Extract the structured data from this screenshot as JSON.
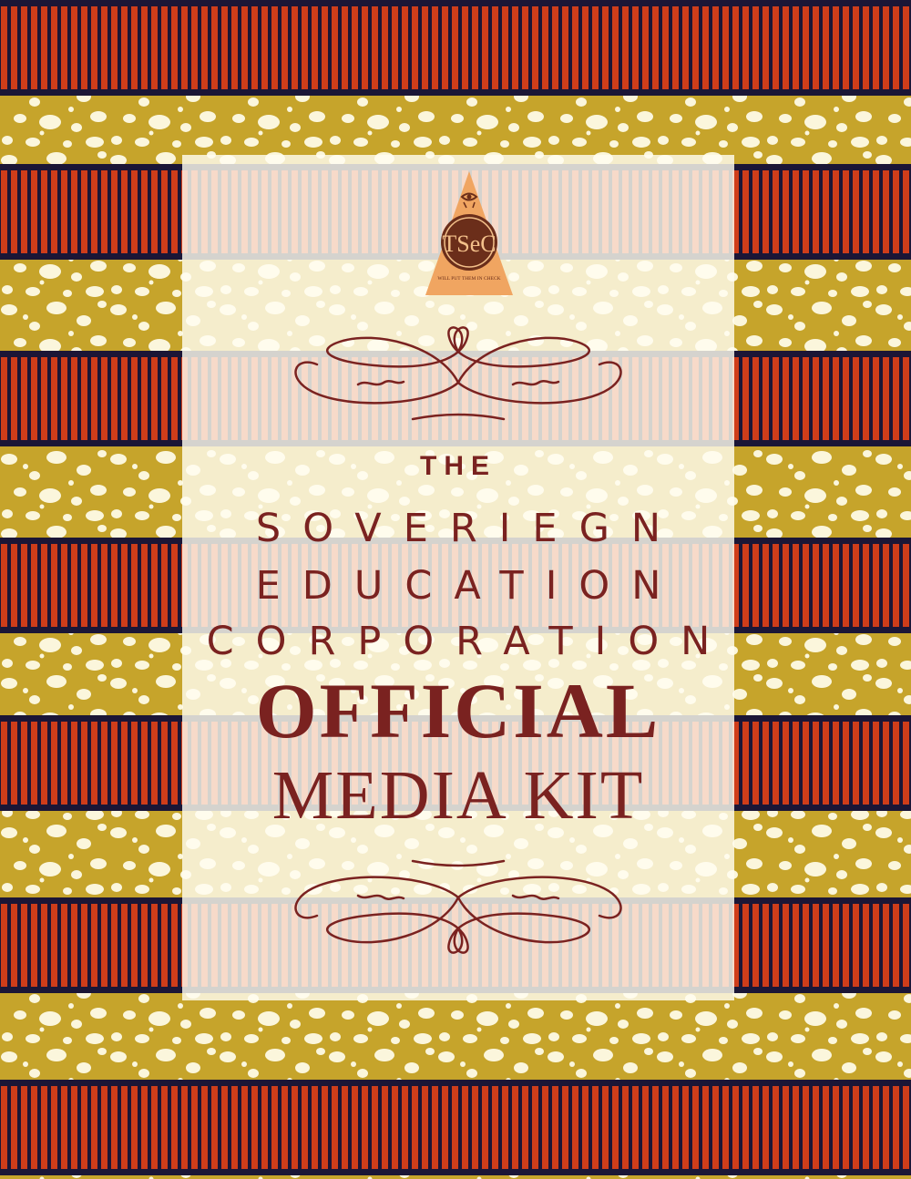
{
  "colors": {
    "primary": "#7a2220",
    "stripe_red": "#cf3d1a",
    "stripe_dark": "#1b1636",
    "mustard": "#c6a42b",
    "dot": "#fbf6dc",
    "logo_orange": "#f0a561",
    "logo_brown": "#6b2e1a",
    "logo_gold": "#f3c08a"
  },
  "logo": {
    "initials": "TSeC",
    "tagline": "WILL PUT THEM IN CHECK"
  },
  "cover": {
    "the": "THE",
    "line1": "SOVERIEGN",
    "line2": "EDUCATION",
    "line3": "CORPORATION",
    "official": "OFFICIAL",
    "media_kit": "MEDIA KIT"
  },
  "icons": {
    "logo": "eye-triangle-emblem-icon",
    "flourish_top": "ornate-scroll-flourish-icon",
    "flourish_bottom": "ornate-scroll-flourish-icon"
  }
}
